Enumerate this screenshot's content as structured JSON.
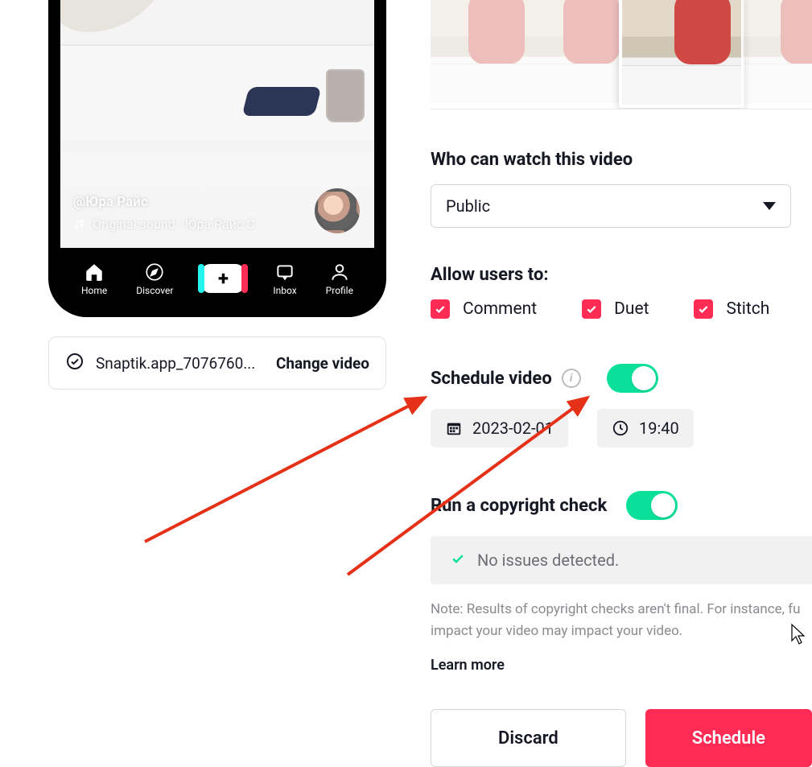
{
  "preview": {
    "username": "@Юра Райс",
    "sound": "Original sound - Юра Райс С",
    "nav": {
      "home": "Home",
      "discover": "Discover",
      "inbox": "Inbox",
      "profile": "Profile"
    }
  },
  "file_bar": {
    "filename": "Snaptik.app_7076760...",
    "change_label": "Change video"
  },
  "privacy": {
    "label": "Who can watch this video",
    "value": "Public"
  },
  "allow": {
    "label": "Allow users to:",
    "comment": "Comment",
    "duet": "Duet",
    "stitch": "Stitch"
  },
  "schedule": {
    "label": "Schedule video",
    "date": "2023-02-01",
    "time": "19:40"
  },
  "copyright": {
    "label": "Run a copyright check",
    "result": "No issues detected.",
    "note_line1": "Note: Results of copyright checks aren't final. For instance, fu",
    "note_line2": "impact your video may impact your video.",
    "learn_more": "Learn more"
  },
  "actions": {
    "discard": "Discard",
    "schedule": "Schedule"
  }
}
